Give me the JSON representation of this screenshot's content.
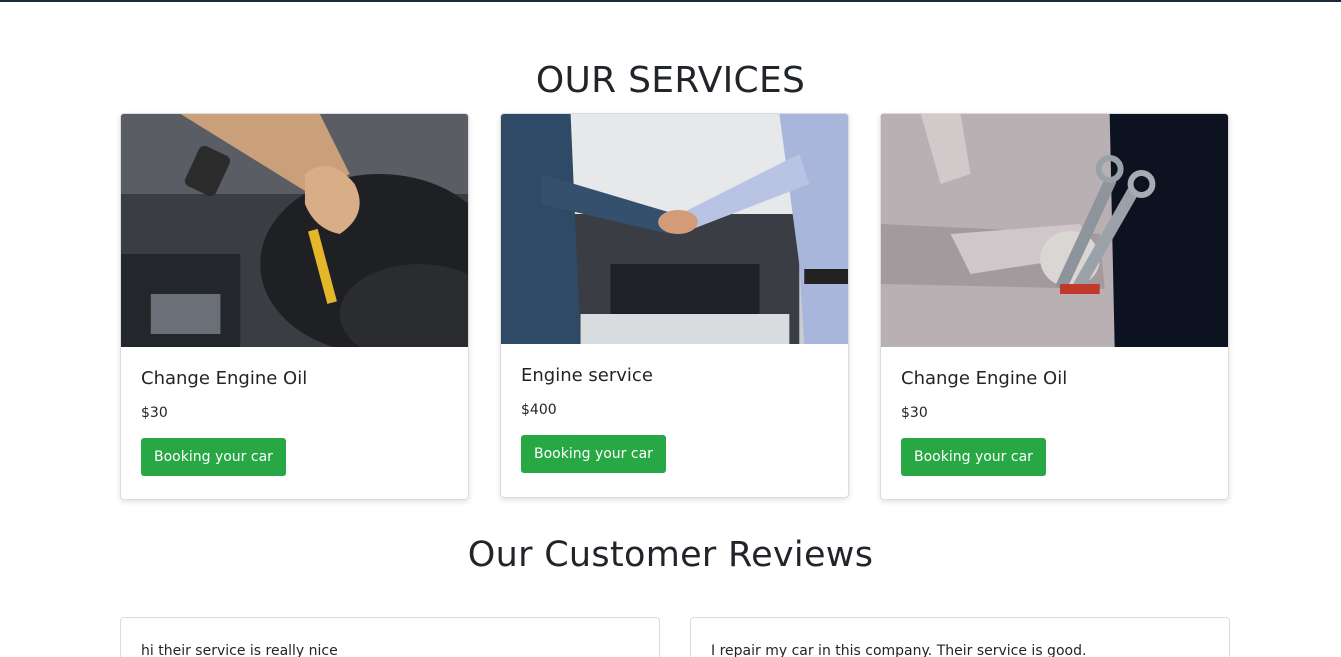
{
  "services": {
    "title": "OUR SERVICES",
    "cards": [
      {
        "image": "engine-oil-dipstick-photo",
        "title": "Change Engine Oil",
        "price": "$30",
        "button": "Booking your car"
      },
      {
        "image": "handshake-mechanic-photo",
        "title": "Engine service",
        "price": "$400",
        "button": "Booking your car"
      },
      {
        "image": "mechanic-wrenches-photo",
        "title": "Change Engine Oil",
        "price": "$30",
        "button": "Booking your car"
      }
    ]
  },
  "reviews": {
    "title": "Our Customer Reviews",
    "items": [
      {
        "text": "hi their service is really nice"
      },
      {
        "text": "I repair my car in this company. Their service is good."
      }
    ]
  },
  "colors": {
    "accent": "#28a745",
    "text": "#212529",
    "top_border": "#1c2a38"
  }
}
